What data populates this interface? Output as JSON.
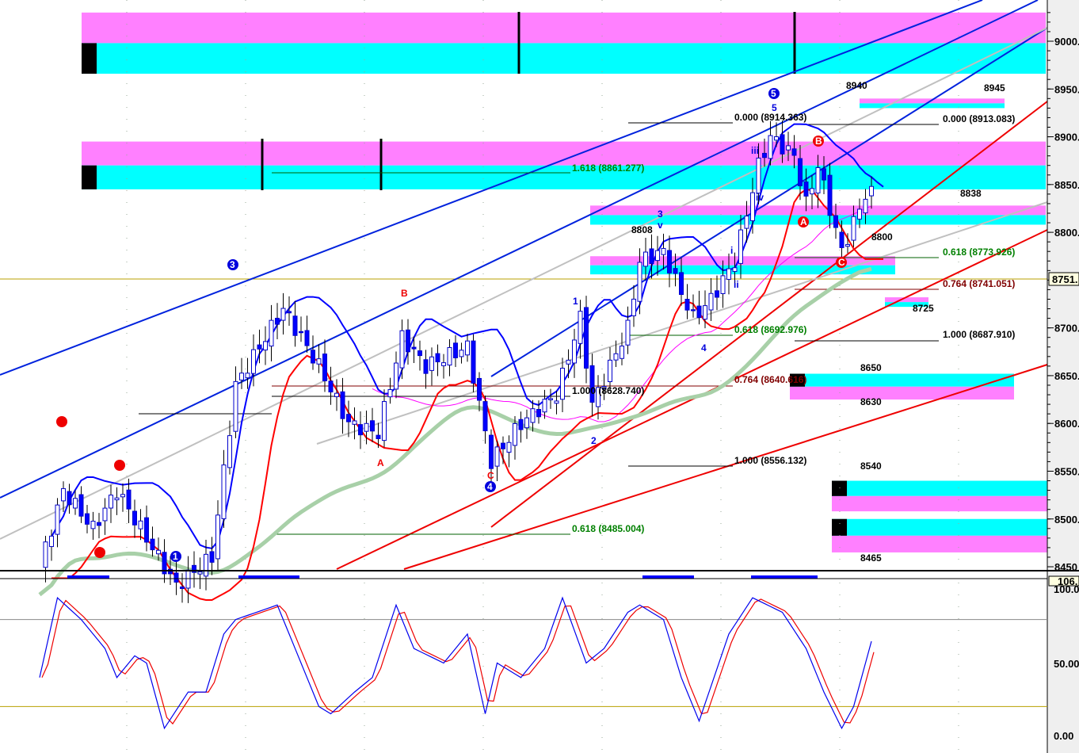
{
  "chart_data": {
    "type": "candlestick",
    "title": "",
    "price_axis": {
      "ticks": [
        "9000.",
        "8950.",
        "8900.",
        "8850.",
        "8800.",
        "8751.",
        "8700.",
        "8650.",
        "8600.",
        "8550.",
        "8500.",
        "8450"
      ],
      "ylim": [
        8450,
        9030
      ],
      "current_price": "8751."
    },
    "close_keypoints": [
      [
        0,
        8450
      ],
      [
        4,
        8530
      ],
      [
        9,
        8490
      ],
      [
        13,
        8530
      ],
      [
        18,
        8480
      ],
      [
        23,
        8430
      ],
      [
        29,
        8460
      ],
      [
        33,
        8640
      ],
      [
        37,
        8680
      ],
      [
        41,
        8720
      ],
      [
        47,
        8660
      ],
      [
        52,
        8600
      ],
      [
        57,
        8590
      ],
      [
        61,
        8690
      ],
      [
        65,
        8660
      ],
      [
        72,
        8680
      ],
      [
        76,
        8560
      ],
      [
        81,
        8600
      ],
      [
        87,
        8630
      ],
      [
        91,
        8710
      ],
      [
        93,
        8620
      ],
      [
        99,
        8700
      ],
      [
        101,
        8770
      ],
      [
        105,
        8780
      ],
      [
        107,
        8750
      ],
      [
        110,
        8710
      ],
      [
        113,
        8730
      ],
      [
        117,
        8770
      ],
      [
        121,
        8870
      ],
      [
        123,
        8900
      ],
      [
        127,
        8880
      ],
      [
        129,
        8830
      ],
      [
        131,
        8870
      ],
      [
        135,
        8780
      ],
      [
        139,
        8840
      ]
    ],
    "zones": [
      {
        "price_top": 9030,
        "price_bottom": 8966,
        "colors": [
          "#ff80ff",
          "#00ffff"
        ]
      },
      {
        "price_top": 8895,
        "price_bottom": 8845,
        "colors": [
          "#ff80ff",
          "#00ffff"
        ]
      },
      {
        "price_top": 8828,
        "price_bottom": 8808,
        "label": "8838",
        "colors": [
          "#ff80ff",
          "#00ffff"
        ]
      },
      {
        "price_top": 8775,
        "price_bottom": 8756,
        "colors": [
          "#ff80ff",
          "#00ffff"
        ]
      },
      {
        "price_top": 8940,
        "price_bottom": 8930,
        "label": "8945",
        "label2": "8940"
      },
      {
        "price_top": 8732,
        "price_bottom": 8722,
        "label": "8725"
      },
      {
        "price_top": 8652,
        "price_bottom": 8625,
        "label": "8650",
        "label2": "8630"
      },
      {
        "price_top": 8540,
        "price_bottom": 8508,
        "label": "8540"
      },
      {
        "price_top": 8500,
        "price_bottom": 8465,
        "label": "8465"
      }
    ],
    "level_labels": {
      "l8800": "8800",
      "l8808": "8808"
    },
    "fib_labels": {
      "f1": "0.000 (8914.363)",
      "f2": "0.000 (8913.083)",
      "f3": "1.618 (8861.277)",
      "f4": "0.618 (8773.926)",
      "f5": "0.764 (8741.051)",
      "f6": "0.618 (8692.976)",
      "f7": "1.000 (8687.910)",
      "f8": "0.764 (8640.616)",
      "f9": "1.000 (8628.740)",
      "f10": "1.000 (8556.132)",
      "f11": "0.618 (8485.004)"
    },
    "wave_labels": {
      "w5a": "5",
      "w3": "3",
      "w4": "4",
      "w1": "1",
      "w2": "2",
      "wA": "A",
      "wB": "B",
      "wC": "C",
      "wc3": "3",
      "wc5": "5",
      "wc4": "4",
      "wc1": "1",
      "wi": "i",
      "wii": "ii",
      "wiii": "iii",
      "wiv": "iv",
      "wv": "v",
      "wBr": "B",
      "wAr": "A",
      "wCr": "C"
    },
    "stochastic": {
      "axis_ticks": [
        "106.",
        "100.0",
        "50.00",
        "0.00"
      ],
      "ylim": [
        0,
        100
      ],
      "levels": [
        80,
        20
      ],
      "keypoints": [
        [
          0,
          40
        ],
        [
          3,
          95
        ],
        [
          7,
          80
        ],
        [
          11,
          60
        ],
        [
          13,
          40
        ],
        [
          16,
          55
        ],
        [
          18,
          50
        ],
        [
          21,
          5
        ],
        [
          25,
          30
        ],
        [
          28,
          30
        ],
        [
          31,
          70
        ],
        [
          33,
          80
        ],
        [
          40,
          90
        ],
        [
          43,
          60
        ],
        [
          47,
          20
        ],
        [
          49,
          15
        ],
        [
          53,
          30
        ],
        [
          56,
          40
        ],
        [
          60,
          90
        ],
        [
          63,
          60
        ],
        [
          68,
          50
        ],
        [
          72,
          70
        ],
        [
          75,
          15
        ],
        [
          77,
          50
        ],
        [
          81,
          40
        ],
        [
          85,
          60
        ],
        [
          88,
          95
        ],
        [
          92,
          50
        ],
        [
          95,
          60
        ],
        [
          99,
          85
        ],
        [
          101,
          90
        ],
        [
          105,
          80
        ],
        [
          108,
          40
        ],
        [
          111,
          10
        ],
        [
          116,
          70
        ],
        [
          120,
          95
        ],
        [
          125,
          85
        ],
        [
          129,
          60
        ],
        [
          132,
          30
        ],
        [
          135,
          5
        ],
        [
          137,
          20
        ],
        [
          140,
          65
        ]
      ]
    }
  },
  "colors": {
    "up": "#ffffff",
    "down": "#0000ff",
    "band_upper": "#0000ff",
    "band_lower": "#ff0000",
    "ma_long": "#a8d0a8",
    "ma_mid": "#ff00ff"
  }
}
